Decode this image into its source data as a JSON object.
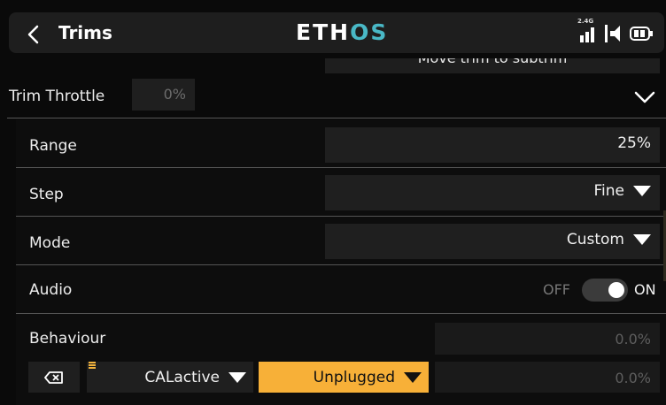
{
  "header": {
    "title": "Trims",
    "logo_part1": "ETH",
    "logo_part2": "OS",
    "radio_band": "2.4G"
  },
  "partial_row": {
    "label": "Move trim to subtrim"
  },
  "trim_throttle": {
    "label": "Trim Throttle",
    "value": "0%"
  },
  "rows": {
    "range": {
      "label": "Range",
      "value": "25%"
    },
    "step": {
      "label": "Step",
      "value": "Fine"
    },
    "mode": {
      "label": "Mode",
      "value": "Custom"
    },
    "audio": {
      "label": "Audio",
      "off_label": "OFF",
      "on_label": "ON",
      "state": "on"
    },
    "behaviour": {
      "label": "Behaviour",
      "value_top": "0.0%",
      "value_bottom": "0.0%",
      "switch_value": "CALactive",
      "state_value": "Unplugged"
    }
  },
  "colors": {
    "accent_logo": "#49b8c6",
    "highlight": "#f7b038",
    "background": "#0a0a0a",
    "field": "#1f1f1f"
  },
  "icons": [
    "back-chevron-icon",
    "signal-icon",
    "speaker-icon",
    "battery-icon",
    "chevron-down-icon",
    "clear-icon",
    "menu-lines-icon"
  ]
}
